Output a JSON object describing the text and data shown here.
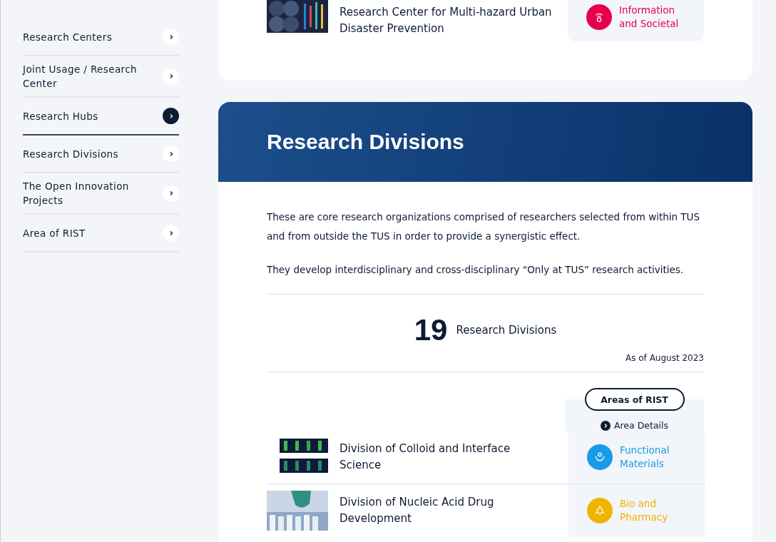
{
  "sidebar": {
    "items": [
      {
        "label": "Research Centers",
        "selected": false
      },
      {
        "label": "Joint Usage / Research Center",
        "selected": false
      },
      {
        "label": "Research Hubs",
        "selected": true
      },
      {
        "label": "Research Divisions",
        "selected": false
      },
      {
        "label": "The Open Innovation Projects",
        "selected": false
      },
      {
        "label": "Area of RIST",
        "selected": false
      }
    ]
  },
  "top_card": {
    "entries": [
      {
        "kind": "picture",
        "title": "Research Center for Multi-hazard Urban Disaster Prevention",
        "area": {
          "label": "Information and Societal",
          "color": "#e6004c",
          "kind": "signal"
        }
      }
    ]
  },
  "section": {
    "title": "Research Divisions",
    "paragraphs": [
      "These are core research organizations comprised of researchers selected from within TUS and from outside the TUS in order to provide a synergistic effect.",
      "They develop interdisciplinary and cross-disciplinary “Only at TUS” research activities."
    ],
    "count": "19",
    "count_label": "Research Divisions",
    "as_of": "As of August 2023",
    "areas_button": "Areas of RIST",
    "area_details": "Area Details",
    "entries": [
      {
        "kind": "picture",
        "title": "Division of Colloid and Interface Science",
        "area": {
          "label": "Functional Materials",
          "color": "#1a9be6",
          "kind": "hands"
        }
      },
      {
        "kind": "picture",
        "title": "Division of Nucleic Acid Drug Development",
        "area": {
          "label": "Bio and Pharmacy",
          "color": "#f0b400",
          "kind": "molecule"
        }
      }
    ]
  }
}
